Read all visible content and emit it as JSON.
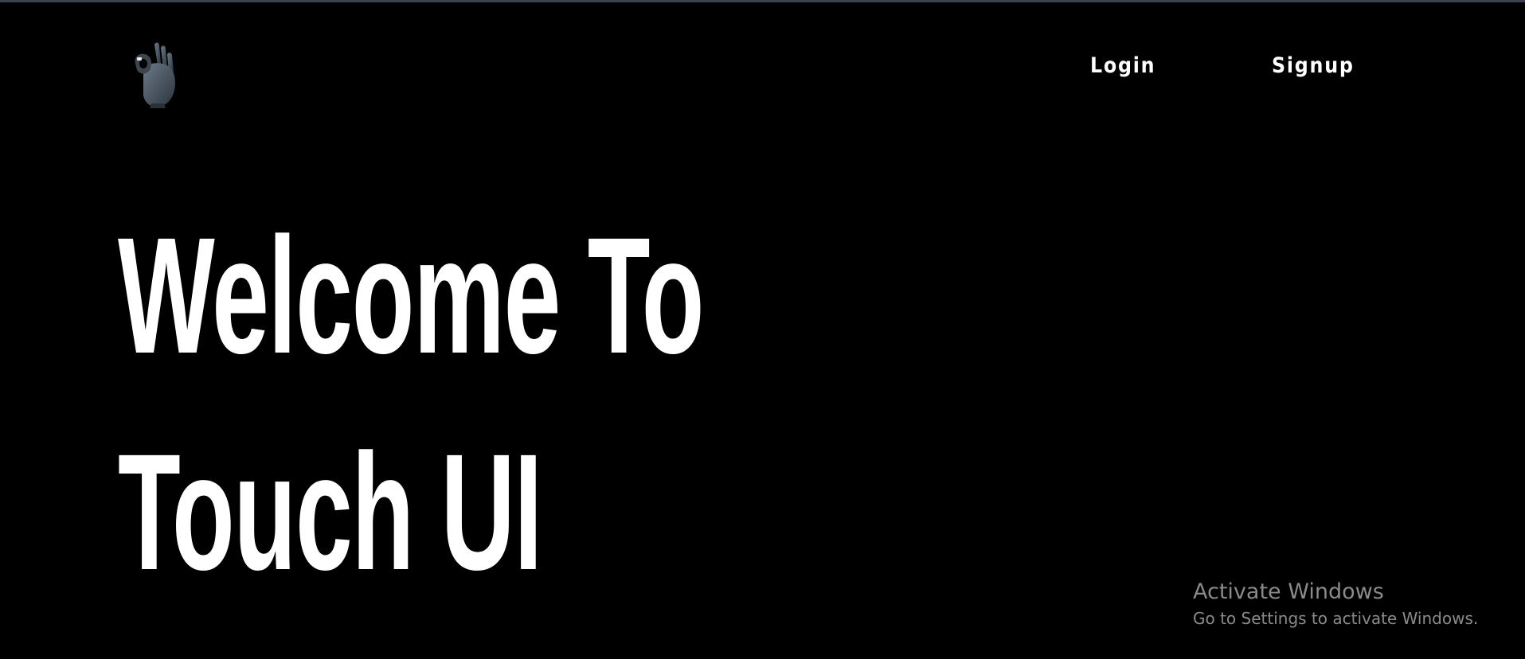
{
  "header": {
    "logo_icon": "ok-hand-icon",
    "nav": [
      {
        "label": "Login"
      },
      {
        "label": "Signup"
      }
    ]
  },
  "hero": {
    "line1": "Welcome To",
    "line2": "Touch UI"
  },
  "watermark": {
    "title": "Activate Windows",
    "subtitle": "Go to Settings to activate Windows."
  },
  "colors": {
    "background": "#000000",
    "text": "#ffffff",
    "watermark": "#8a8a8a",
    "top_border": "#3a4250"
  }
}
